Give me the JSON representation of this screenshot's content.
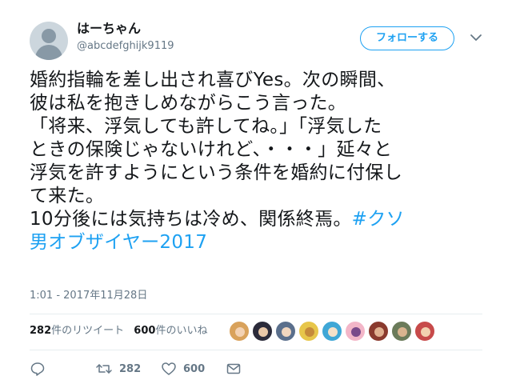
{
  "user": {
    "display_name": "はーちゃん",
    "handle": "@abcdefghijk9119"
  },
  "header": {
    "follow_label": "フォローする"
  },
  "tweet": {
    "lines": [
      "婚約指輪を差し出され喜びYes。次の瞬間、",
      "彼は私を抱きしめながらこう言った。",
      "「将来、浮気しても許してね。」「浮気した",
      "ときの保険じゃないけれど、・・・」延々と",
      "浮気を許すようにという条件を婚約に付保し",
      "て来た。",
      "10分後には気持ちは冷め、関係終焉。"
    ],
    "hashtag_part1": "#クソ",
    "hashtag_part2": "男オブザイヤー2017",
    "timestamp": "1:01 - 2017年11月28日"
  },
  "stats": {
    "retweet_count": "282",
    "retweet_label": "件のリツイート",
    "like_count": "600",
    "like_label": "件のいいね"
  },
  "likers": [
    {
      "bg": "#d9a25b",
      "face": "#f3d2b3"
    },
    {
      "bg": "#2b2b3a",
      "face": "#e8c8a8"
    },
    {
      "bg": "#5a6f8c",
      "face": "#f0d6bf"
    },
    {
      "bg": "#e7c64a",
      "face": "#c58a3a"
    },
    {
      "bg": "#3fa7d6",
      "face": "#f4e1c9"
    },
    {
      "bg": "#f3b6c8",
      "face": "#7a4a8a"
    },
    {
      "bg": "#8a3a2e",
      "face": "#e0b090"
    },
    {
      "bg": "#6b7b5a",
      "face": "#d9b48f"
    },
    {
      "bg": "#c74a4a",
      "face": "#f2d0b0"
    }
  ],
  "actions": {
    "retweet_count": "282",
    "like_count": "600"
  },
  "colors": {
    "accent": "#1da1f2",
    "secondary_text": "#657786"
  }
}
